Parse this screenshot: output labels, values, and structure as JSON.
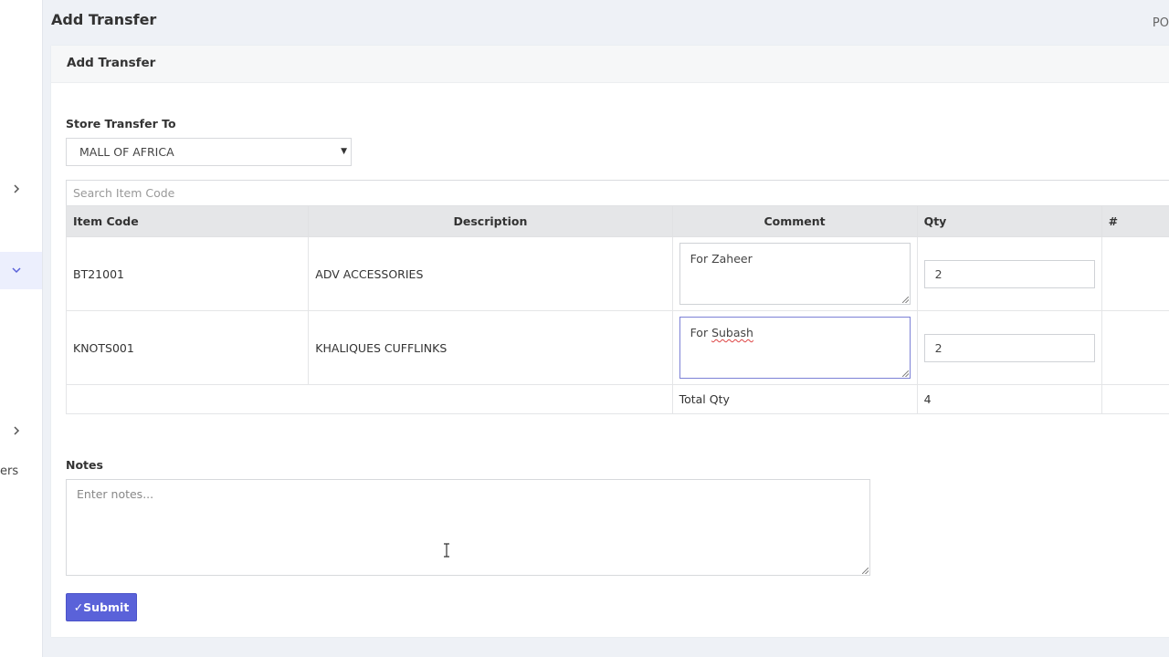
{
  "page": {
    "title": "Add Transfer",
    "right_truncated": "PO"
  },
  "sidebar": {
    "partial_label": "ers"
  },
  "card": {
    "header": "Add Transfer",
    "store_label": "Store Transfer To",
    "store_value": "MALL OF AFRICA",
    "search_placeholder": "Search Item Code",
    "columns": [
      "Item Code",
      "Description",
      "Comment",
      "Qty",
      "#"
    ],
    "rows": [
      {
        "code": "BT21001",
        "description": "ADV ACCESSORIES",
        "comment": "For Zaheer",
        "qty": "2"
      },
      {
        "code": "KNOTS001",
        "description": "KHALIQUES CUFFLINKS",
        "comment_prefix": "For ",
        "comment_word": "Subash",
        "qty": "2"
      }
    ],
    "total_label": "Total Qty",
    "total_value": "4",
    "notes_label": "Notes",
    "notes_placeholder": "Enter notes...",
    "submit_label": "Submit"
  },
  "colors": {
    "accent": "#5a62d9",
    "sidebar_active": "#eceffd"
  }
}
